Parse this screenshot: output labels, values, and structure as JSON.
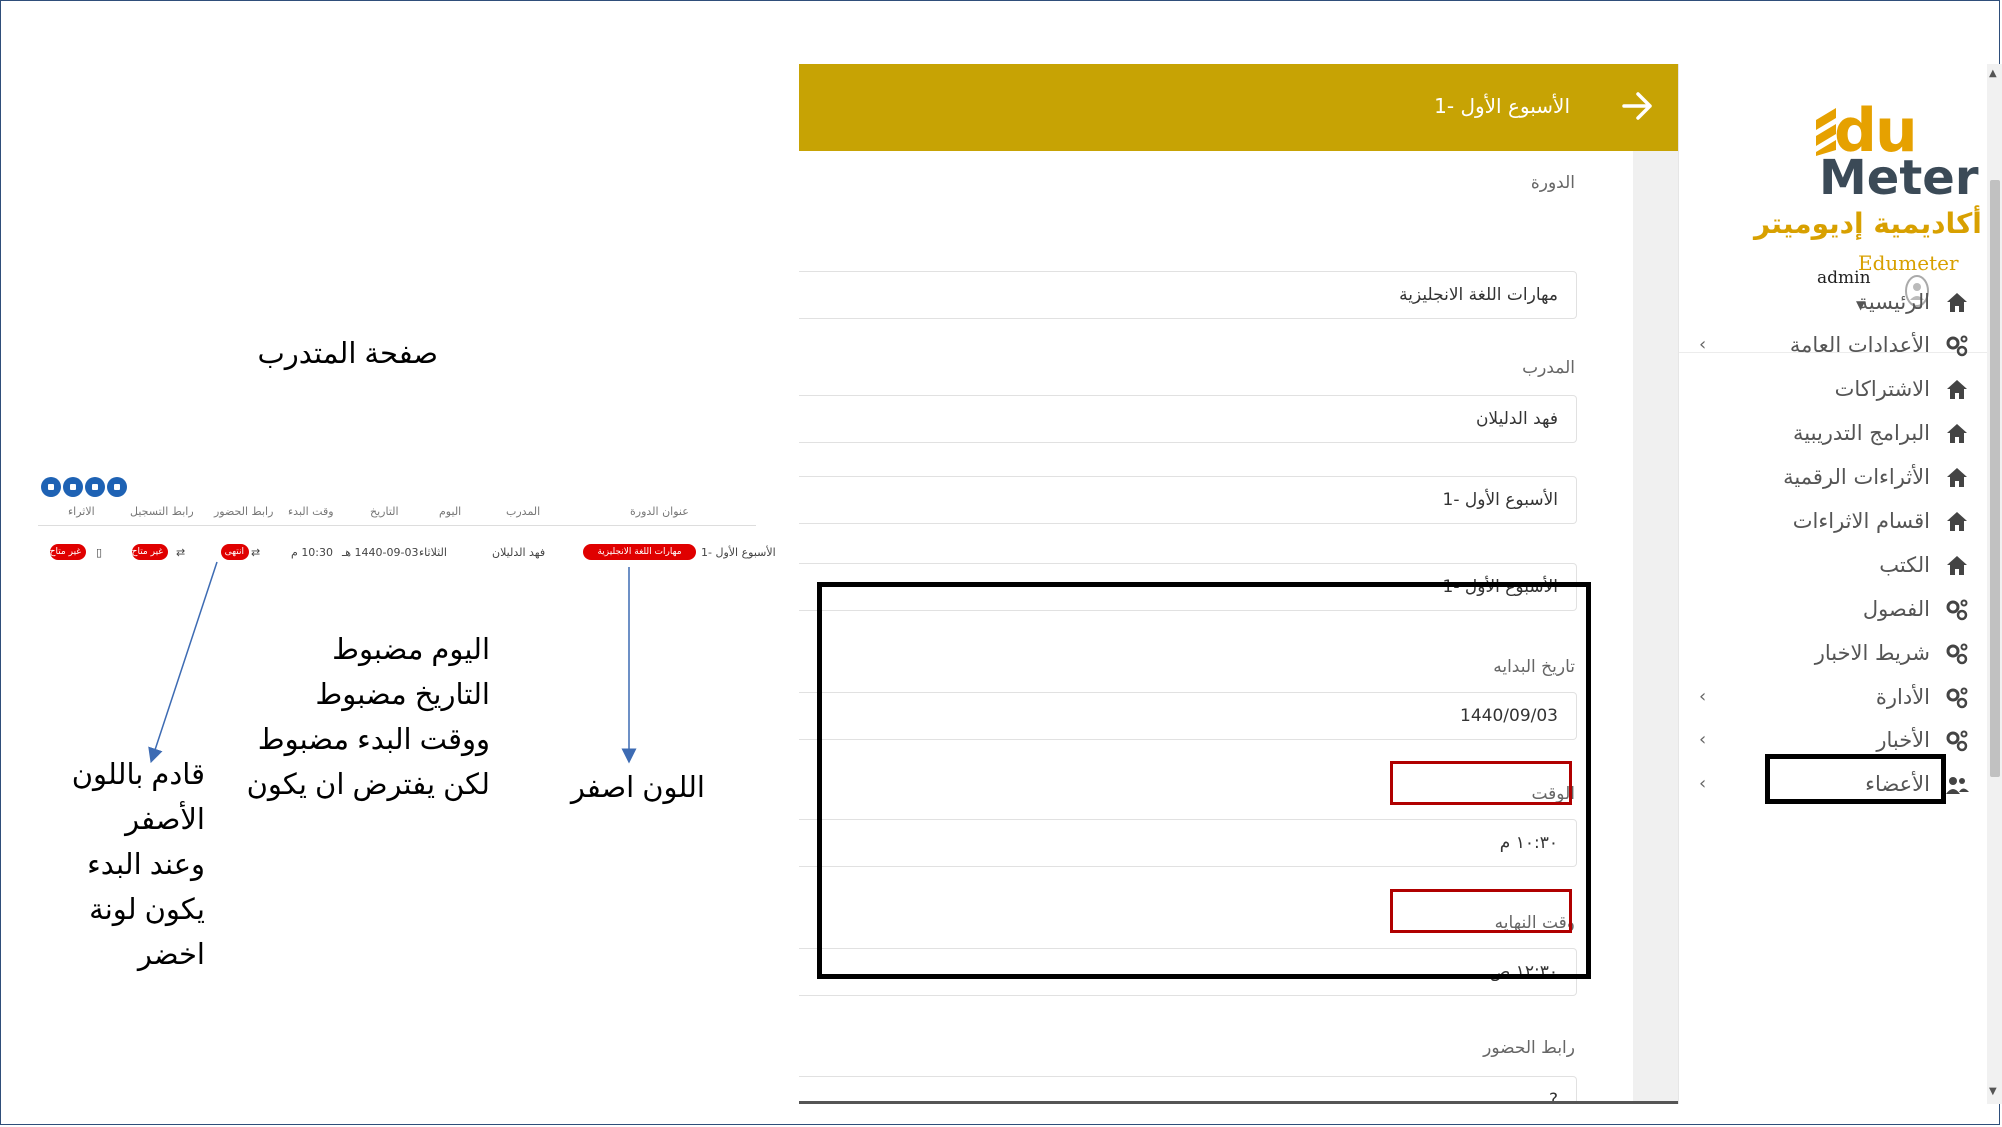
{
  "app": {
    "header_title": "الأسبوع الأول -1",
    "form": {
      "course_label": "الدورة",
      "course_value": "مهارات اللغة الانجليزية",
      "trainer_label": "المدرب",
      "trainer_value": "فهد الدليلان",
      "title_ar_value": "الأسبوع الأول -1",
      "title_en_value": "الأسبوع الأول -1",
      "start_date_label": "تاريخ البدايه",
      "start_date_value": "1440/09/03",
      "time_label": "الوقت",
      "time_value": "١٠:٣٠ م",
      "end_time_label": "وقت النهايه",
      "end_time_value": "١٢:٣٠ ص",
      "attendance_link_label": "رابط الحضور",
      "attendance_link_value": "?"
    },
    "sidebar": {
      "logo_du": "du",
      "logo_meter": "Meter",
      "logo_arabic": "أكاديمية إديوميتر",
      "logo_en": "Edumeter",
      "user_name": "admin",
      "items": [
        {
          "label": "الرئيسية",
          "icon": "home-icon"
        },
        {
          "label": "الأعدادات العامة",
          "icon": "gears-icon",
          "chevron": true
        },
        {
          "label": "الاشتراكات",
          "icon": "home-icon"
        },
        {
          "label": "البرامج التدريبية",
          "icon": "home-icon"
        },
        {
          "label": "الأثراءات الرقمية",
          "icon": "home-icon"
        },
        {
          "label": "اقسام الاثراءات",
          "icon": "home-icon"
        },
        {
          "label": "الكتب",
          "icon": "home-icon"
        },
        {
          "label": "الفصول",
          "icon": "gears-icon"
        },
        {
          "label": "شريط الاخبار",
          "icon": "gears-icon"
        },
        {
          "label": "الأدارة",
          "icon": "gears-icon",
          "chevron": true
        },
        {
          "label": "الأخبار",
          "icon": "gears-icon",
          "chevron": true
        },
        {
          "label": "الأعضاء",
          "icon": "users-icon",
          "chevron": true
        }
      ]
    }
  },
  "annotations": {
    "page_title": "صفحة المتدرب",
    "note_right": "اللون اصفر",
    "note_middle": [
      "اليوم مضبوط",
      "التاريخ مضبوط",
      "ووقت البدء مضبوط",
      "لكن يفترض ان يكون"
    ],
    "note_left": [
      "قادم باللون",
      "الأصفر",
      "وعند البدء",
      "يكون لونة",
      "اخضر"
    ]
  },
  "mini_table": {
    "headers": [
      "عنوان الدورة",
      "المدرب",
      "اليوم",
      "التاريخ",
      "وقت البدء",
      "رابط الحضور",
      "رابط التسجيل",
      "الاثراء"
    ],
    "row": {
      "title": "الأسبوع الأول -1",
      "course_badge": "مهارات اللغة الانجليزية",
      "trainer": "فهد الدليلان",
      "day": "الثلاثاء",
      "date": "1440-09-03 هـ",
      "time": "10:30 م",
      "attendance_badge": "انتهى",
      "registration_badge": "غير متاح",
      "enrichment_badge": "غير متاح"
    }
  },
  "colors": {
    "header_bg": "#c7a304",
    "badge_red": "#e00000",
    "highlight_red": "#b00000",
    "logo_gold": "#e6a100",
    "action_blue": "#1e62b4"
  }
}
